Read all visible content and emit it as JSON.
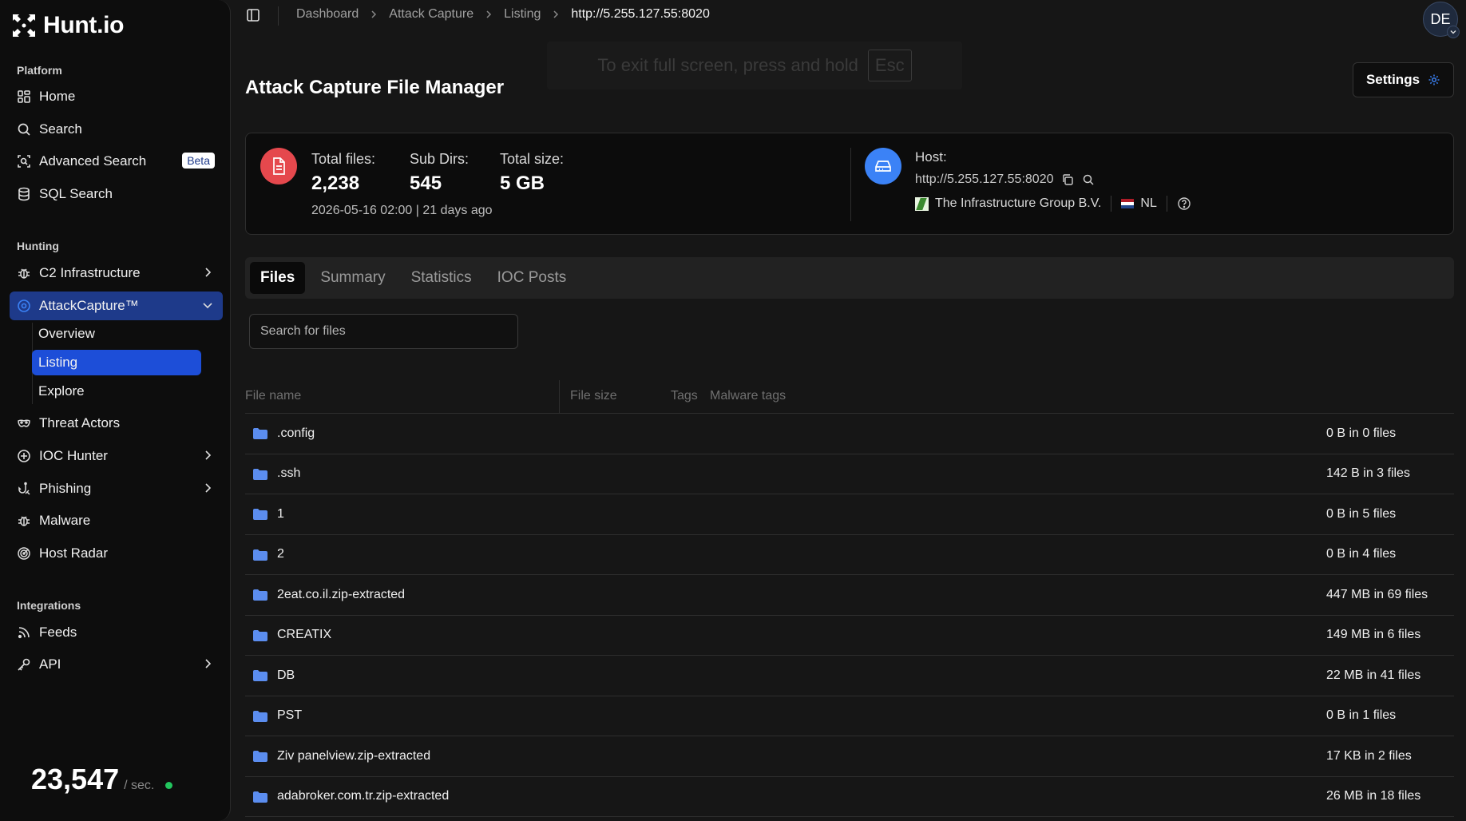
{
  "brand": {
    "name": "Hunt.io"
  },
  "sidebar": {
    "sections": {
      "platform": "Platform",
      "hunting": "Hunting",
      "integrations": "Integrations"
    },
    "platform_items": [
      {
        "label": "Home",
        "icon": "grid-icon"
      },
      {
        "label": "Search",
        "icon": "search-icon"
      },
      {
        "label": "Advanced Search",
        "icon": "scan-search-icon",
        "badge": "Beta"
      },
      {
        "label": "SQL Search",
        "icon": "database-icon"
      }
    ],
    "hunting_items": [
      {
        "label": "C2 Infrastructure",
        "icon": "bug-icon"
      },
      {
        "label": "AttackCapture™",
        "icon": "capture-icon"
      },
      {
        "label": "Threat Actors",
        "icon": "mask-icon"
      },
      {
        "label": "IOC Hunter",
        "icon": "plus-circle-icon"
      },
      {
        "label": "Phishing",
        "icon": "fish-hook-icon"
      },
      {
        "label": "Malware",
        "icon": "bug-icon"
      },
      {
        "label": "Host Radar",
        "icon": "radar-icon"
      }
    ],
    "attack_capture_sub": [
      "Overview",
      "Listing",
      "Explore"
    ],
    "integrations_items": [
      {
        "label": "Feeds",
        "icon": "rss-icon"
      },
      {
        "label": "API",
        "icon": "key-icon"
      }
    ],
    "counter": {
      "value": "23,547",
      "unit": "/ sec."
    }
  },
  "breadcrumb": [
    "Dashboard",
    "Attack Capture",
    "Listing",
    "http://5.255.127.55:8020"
  ],
  "user": {
    "initials": "DE"
  },
  "fullscreen_notice": {
    "text": "To exit full screen, press and hold",
    "key": "Esc"
  },
  "page": {
    "title": "Attack Capture File Manager",
    "settings_label": "Settings"
  },
  "stats": {
    "total_files_label": "Total files:",
    "total_files": "2,238",
    "sub_dirs_label": "Sub Dirs:",
    "sub_dirs": "545",
    "total_size_label": "Total size:",
    "total_size": "5 GB",
    "date": "2026-05-16 02:00",
    "ago": "21 days ago"
  },
  "host": {
    "label": "Host:",
    "url": "http://5.255.127.55:8020",
    "org": "The Infrastructure Group B.V.",
    "country": "NL"
  },
  "tabs": [
    "Files",
    "Summary",
    "Statistics",
    "IOC Posts"
  ],
  "search": {
    "placeholder": "Search for files"
  },
  "table": {
    "columns": [
      "File name",
      "File size",
      "Tags",
      "Malware tags"
    ],
    "rows": [
      {
        "name": ".config",
        "size": "0 B in 0 files"
      },
      {
        "name": ".ssh",
        "size": "142 B in 3 files"
      },
      {
        "name": "1",
        "size": "0 B in 5 files"
      },
      {
        "name": "2",
        "size": "0 B in 4 files"
      },
      {
        "name": "2eat.co.il.zip-extracted",
        "size": "447 MB in 69 files"
      },
      {
        "name": "CREATIX",
        "size": "149 MB in 6 files"
      },
      {
        "name": "DB",
        "size": "22 MB in 41 files"
      },
      {
        "name": "PST",
        "size": "0 B in 1 files"
      },
      {
        "name": "Ziv panelview.zip-extracted",
        "size": "17 KB in 2 files"
      },
      {
        "name": "adabroker.com.tr.zip-extracted",
        "size": "26 MB in 18 files"
      }
    ]
  },
  "colors": {
    "accent": "#1d4ed8",
    "active_nav": "#1e3a8a",
    "file_icon": "#e5484d",
    "host_icon": "#3b82f6",
    "folder": "#5b8def",
    "live": "#22c55e"
  }
}
